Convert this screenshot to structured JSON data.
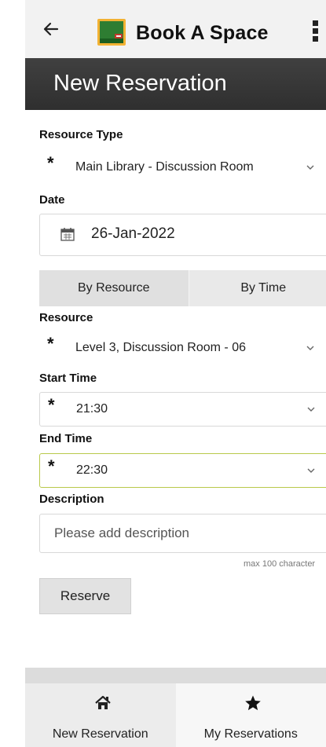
{
  "appbar": {
    "title": "Book A Space",
    "back_icon": "arrow-left-icon",
    "menu_icon": "more-vertical-icon"
  },
  "page": {
    "title": "New Reservation"
  },
  "form": {
    "resource_type": {
      "label": "Resource Type",
      "required_mark": "*",
      "value": "Main Library - Discussion Room"
    },
    "date": {
      "label": "Date",
      "value": "26-Jan-2022"
    },
    "toggle": {
      "by_resource": "By Resource",
      "by_time": "By Time"
    },
    "resource": {
      "label": "Resource",
      "required_mark": "*",
      "value": "Level 3, Discussion Room - 06"
    },
    "start_time": {
      "label": "Start Time",
      "required_mark": "*",
      "value": "21:30"
    },
    "end_time": {
      "label": "End Time",
      "required_mark": "*",
      "value": "22:30"
    },
    "description": {
      "label": "Description",
      "placeholder": "Please add description",
      "max_note": "max 100 character"
    },
    "reserve_label": "Reserve"
  },
  "bottom_nav": {
    "items": [
      {
        "label": "New Reservation",
        "icon": "home-icon"
      },
      {
        "label": "My Reservations",
        "icon": "star-icon"
      }
    ]
  },
  "colors": {
    "title_bar": "#3a3a3a",
    "accent_border": "#b9c94a"
  }
}
